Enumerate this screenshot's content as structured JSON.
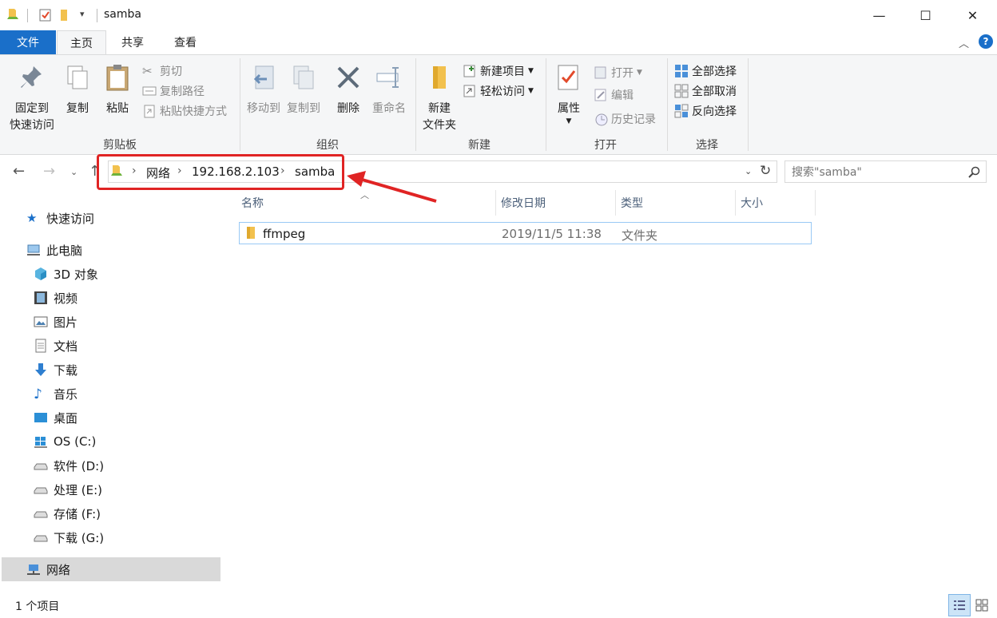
{
  "titlebar": {
    "title": "samba",
    "minimize": "—",
    "maximize": "☐",
    "close": "✕"
  },
  "tabs": {
    "file": "文件",
    "home": "主页",
    "share": "共享",
    "view": "查看"
  },
  "ribbon": {
    "clipboard": {
      "label": "剪贴板",
      "pin": "固定到\n快速访问",
      "copy": "复制",
      "paste": "粘贴",
      "cut": "剪切",
      "copy_path": "复制路径",
      "paste_shortcut": "粘贴快捷方式"
    },
    "organize": {
      "label": "组织",
      "move_to": "移动到",
      "copy_to": "复制到",
      "delete": "删除",
      "rename": "重命名"
    },
    "new": {
      "label": "新建",
      "new_folder": "新建\n文件夹",
      "new_item": "新建项目",
      "easy_access": "轻松访问"
    },
    "open": {
      "label": "打开",
      "properties": "属性",
      "open": "打开",
      "edit": "编辑",
      "history": "历史记录"
    },
    "select": {
      "label": "选择",
      "select_all": "全部选择",
      "select_none": "全部取消",
      "invert": "反向选择"
    }
  },
  "address": {
    "crumbs": [
      "网络",
      "192.168.2.103",
      "samba"
    ]
  },
  "search": {
    "placeholder": "搜索\"samba\""
  },
  "nav": {
    "quick_access": "快速访问",
    "this_pc": "此电脑",
    "items": [
      "3D 对象",
      "视频",
      "图片",
      "文档",
      "下载",
      "音乐",
      "桌面",
      "OS (C:)",
      "软件 (D:)",
      "处理 (E:)",
      "存储 (F:)",
      "下载 (G:)"
    ],
    "network": "网络"
  },
  "columns": {
    "name": "名称",
    "date": "修改日期",
    "type": "类型",
    "size": "大小"
  },
  "files": [
    {
      "name": "ffmpeg",
      "date": "2019/11/5 11:38",
      "type": "文件夹",
      "size": ""
    }
  ],
  "status": {
    "count": "1 个项目"
  },
  "colors": {
    "accent": "#1a6fc9",
    "highlight": "#e02424",
    "folder": "#f2c14e"
  }
}
